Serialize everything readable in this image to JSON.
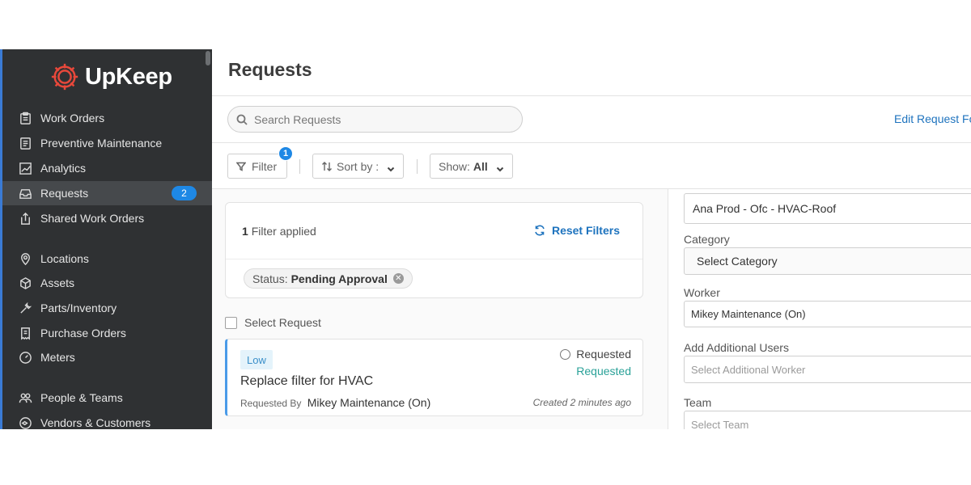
{
  "app": {
    "name": "UpKeep"
  },
  "sidebar": {
    "items": [
      {
        "label": "Work Orders",
        "icon": "clipboard-icon"
      },
      {
        "label": "Preventive Maintenance",
        "icon": "document-icon"
      },
      {
        "label": "Analytics",
        "icon": "chart-icon"
      },
      {
        "label": "Requests",
        "icon": "inbox-icon",
        "badge": "2",
        "active": true
      },
      {
        "label": "Shared Work Orders",
        "icon": "share-icon"
      },
      {
        "label": "Locations",
        "icon": "location-pin-icon"
      },
      {
        "label": "Assets",
        "icon": "cube-icon"
      },
      {
        "label": "Parts/Inventory",
        "icon": "wrench-icon"
      },
      {
        "label": "Purchase Orders",
        "icon": "receipt-icon"
      },
      {
        "label": "Meters",
        "icon": "gauge-icon"
      },
      {
        "label": "People & Teams",
        "icon": "people-icon"
      },
      {
        "label": "Vendors & Customers",
        "icon": "vendors-icon"
      }
    ]
  },
  "header": {
    "title": "Requests"
  },
  "search": {
    "placeholder": "Search Requests"
  },
  "edit_link": "Edit Request Fo",
  "toolbar": {
    "filter_label": "Filter",
    "filter_count": "1",
    "sort_label": "Sort by :",
    "show_label": "Show:",
    "show_value": "All"
  },
  "filters": {
    "count": "1",
    "applied_text": "Filter applied",
    "reset_label": "Reset Filters",
    "chip_key": "Status:",
    "chip_value": "Pending Approval"
  },
  "select_request_label": "Select Request",
  "request": {
    "priority": "Low",
    "title": "Replace filter for HVAC",
    "requested_by_label": "Requested By",
    "requested_by": "Mikey Maintenance (On)",
    "status": "Requested",
    "status_sub": "Requested",
    "created": "Created 2 minutes ago"
  },
  "detail": {
    "location_value": "Ana Prod - Ofc - HVAC-Roof",
    "category_label": "Category",
    "category_placeholder": "Select Category",
    "worker_label": "Worker",
    "worker_value": "Mikey Maintenance (On)",
    "additional_users_label": "Add Additional Users",
    "additional_users_placeholder": "Select Additional Worker",
    "team_label": "Team",
    "team_placeholder": "Select Team"
  },
  "colors": {
    "sidebar_bg": "#2f3133",
    "accent_blue": "#1e88e5",
    "link_blue": "#1e73be",
    "status_green": "#2aa198",
    "logo_red": "#e8483b"
  }
}
